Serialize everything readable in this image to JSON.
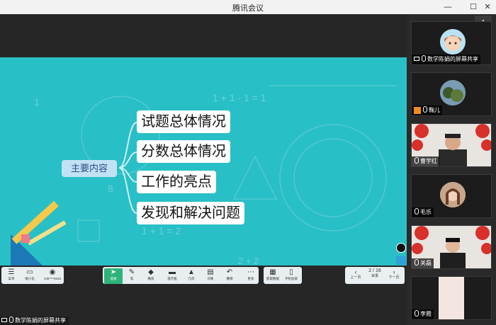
{
  "window": {
    "title": "腾讯会议"
  },
  "slide": {
    "main_node": "主要内容",
    "branches": [
      "试题总体情况",
      "分数总体情况",
      "工作的亮点",
      "发现和解决问题"
    ],
    "bg_math": [
      "1 + 1 - 1 = 1",
      "1 + 1 = 2",
      "2 + 2",
      "1",
      "8"
    ]
  },
  "toolbar": {
    "left": [
      {
        "label": "菜单",
        "icon": "menu-icon"
      },
      {
        "label": "缩小化",
        "icon": "minimize-board-icon"
      },
      {
        "label": "136****6422",
        "icon": "user-avatar-icon"
      }
    ],
    "center": [
      {
        "label": "选择",
        "icon": "cursor-icon",
        "selected": true
      },
      {
        "label": "笔",
        "icon": "pen-icon"
      },
      {
        "label": "橡皮",
        "icon": "eraser-icon"
      },
      {
        "label": "提示框",
        "icon": "bubble-icon"
      },
      {
        "label": "几何",
        "icon": "shape-icon"
      },
      {
        "label": "对象",
        "icon": "object-icon"
      },
      {
        "label": "撤销",
        "icon": "undo-icon"
      },
      {
        "label": "更多",
        "icon": "more-icon"
      },
      {
        "label": "获取数据",
        "icon": "data-icon"
      },
      {
        "label": "手机投屏",
        "icon": "phone-icon"
      }
    ],
    "pager": {
      "prev": "上一页",
      "page": "2 / 16",
      "next": "下一页",
      "mid": "目录"
    }
  },
  "share_label": "数学陈娟的屏幕共享",
  "participants": [
    {
      "name": "数学陈娟的屏幕共享",
      "type": "cartoon"
    },
    {
      "name": "鞠儿",
      "type": "photo"
    },
    {
      "name": "曹宇红",
      "type": "video"
    },
    {
      "name": "毛乐",
      "type": "photo2"
    },
    {
      "name": "关磊",
      "type": "video2"
    },
    {
      "name": "李霞",
      "type": "blank"
    }
  ]
}
